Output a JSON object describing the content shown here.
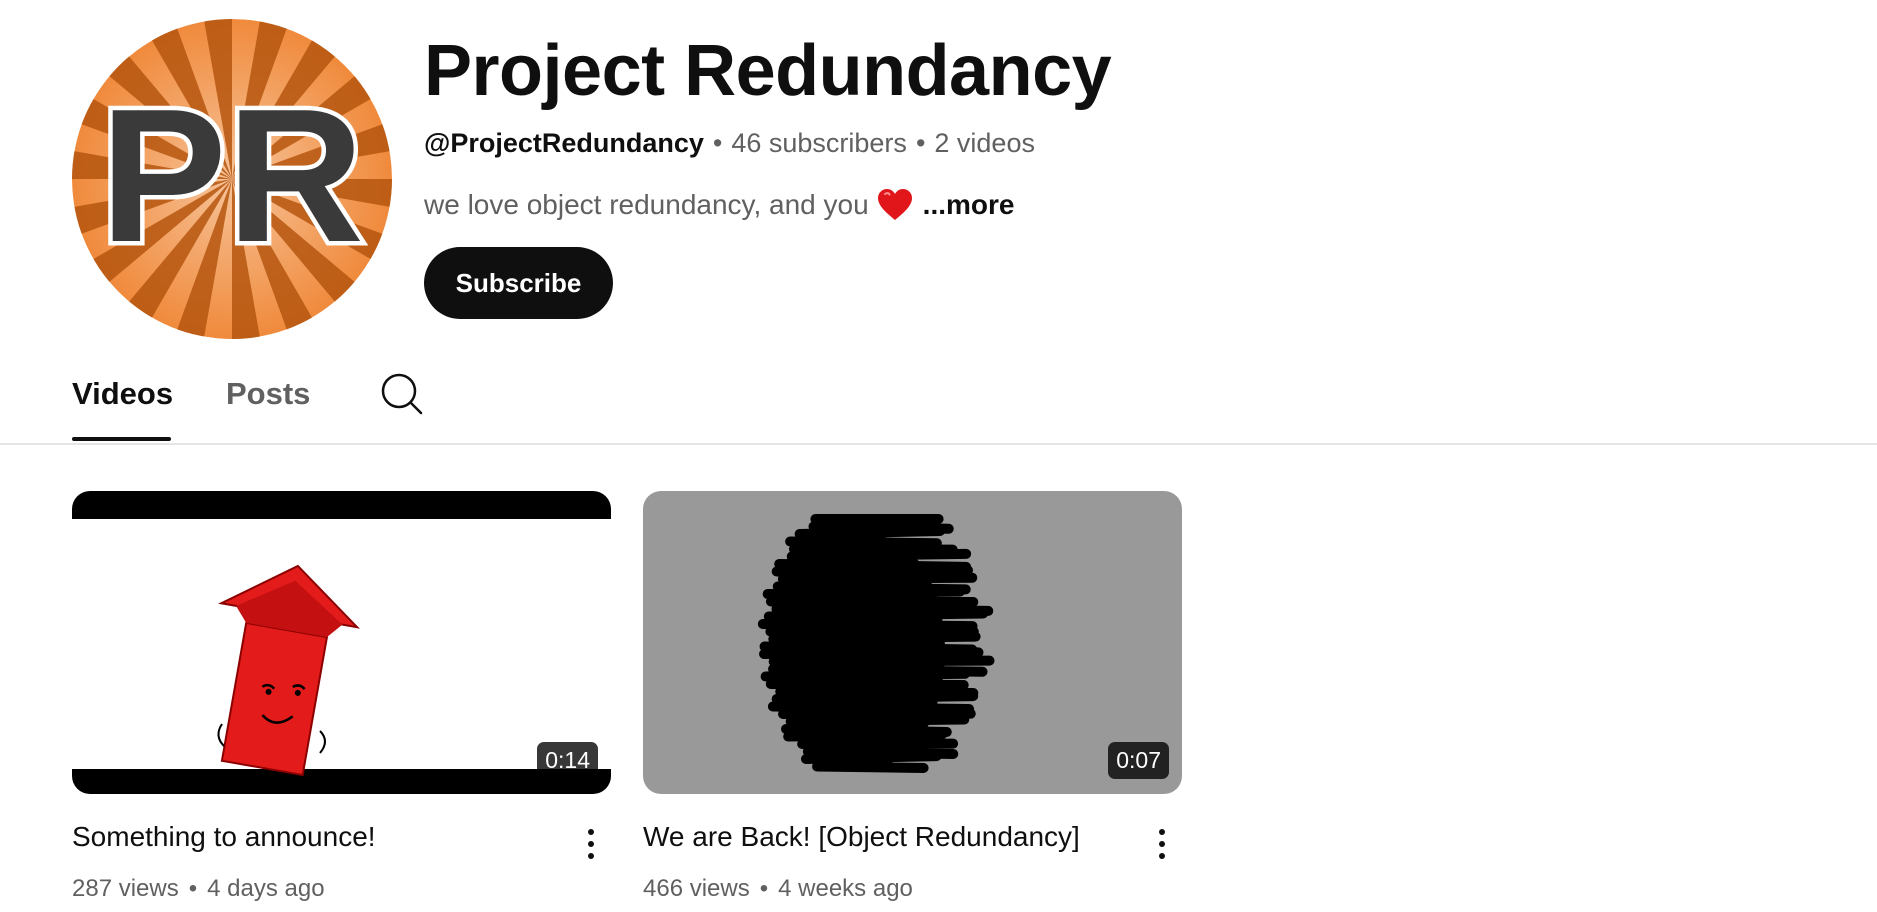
{
  "channel": {
    "avatar_text": "PR",
    "title": "Project Redundancy",
    "handle": "@ProjectRedundancy",
    "separator": "•",
    "subscribers": "46 subscribers",
    "video_count": "2 videos",
    "description": "we love object redundancy, and you",
    "description_icon": "red-heart-emoji",
    "more_label": "...more",
    "subscribe_label": "Subscribe"
  },
  "tabs": [
    {
      "label": "Videos",
      "active": true
    },
    {
      "label": "Posts",
      "active": false
    }
  ],
  "search_icon": "search-icon",
  "videos": [
    {
      "title": "Something to announce!",
      "views": "287 views",
      "separator": "•",
      "age": "4 days ago",
      "duration": "0:14"
    },
    {
      "title": "We are Back! [Object Redundancy]",
      "views": "466 views",
      "separator": "•",
      "age": "4 weeks ago",
      "duration": "0:07"
    }
  ],
  "colors": {
    "avatar_orange": "#f0924a",
    "avatar_ray": "#b5560f",
    "subscribe_bg": "#0f0f0f",
    "thumb2_bg": "#999999",
    "arrow_red": "#e31b1b"
  }
}
